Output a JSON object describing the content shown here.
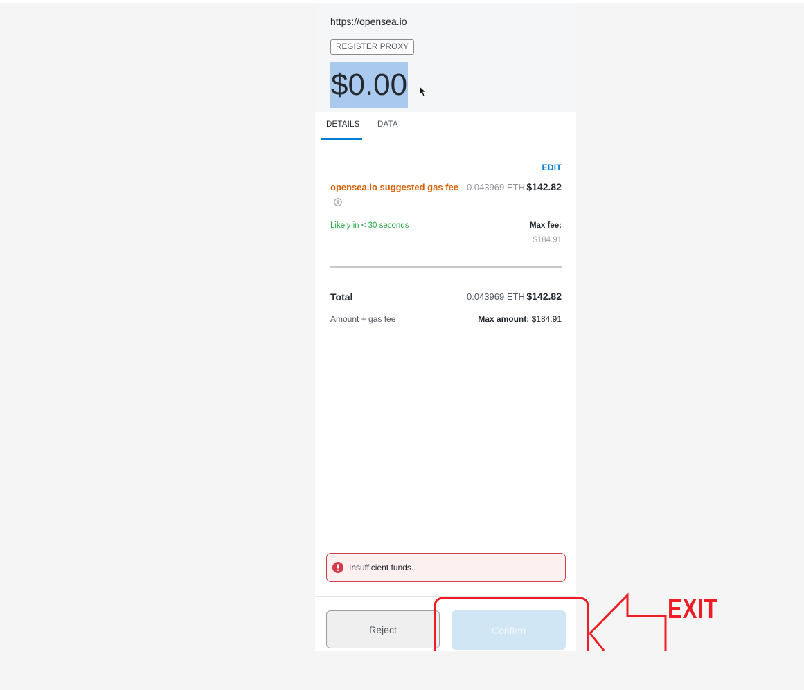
{
  "header": {
    "origin": "https://opensea.io",
    "method": "REGISTER PROXY",
    "amount": "$0.00"
  },
  "tabs": [
    {
      "label": "DETAILS",
      "active": true
    },
    {
      "label": "DATA",
      "active": false
    }
  ],
  "details": {
    "edit_label": "EDIT",
    "gas_label": "opensea.io suggested gas fee",
    "gas_eth": "0.043969 ETH",
    "gas_usd": "$142.82",
    "likely": "Likely in < 30 seconds",
    "max_fee_label": "Max fee:",
    "max_fee_value": "$184.91",
    "total_label": "Total",
    "total_eth": "0.043969 ETH",
    "total_usd": "$142.82",
    "subtotal_label": "Amount + gas fee",
    "max_amount_label": "Max amount:",
    "max_amount_value": "$184.91"
  },
  "error": {
    "message": "Insufficient funds."
  },
  "footer": {
    "reject_label": "Reject",
    "confirm_label": "Confirm"
  },
  "annotation": {
    "label": "EXIT",
    "color": "#ee1c24"
  },
  "colors": {
    "accent": "#037dd6",
    "gas_label": "#d9610a",
    "likely": "#28a745",
    "error": "#d73a49"
  }
}
